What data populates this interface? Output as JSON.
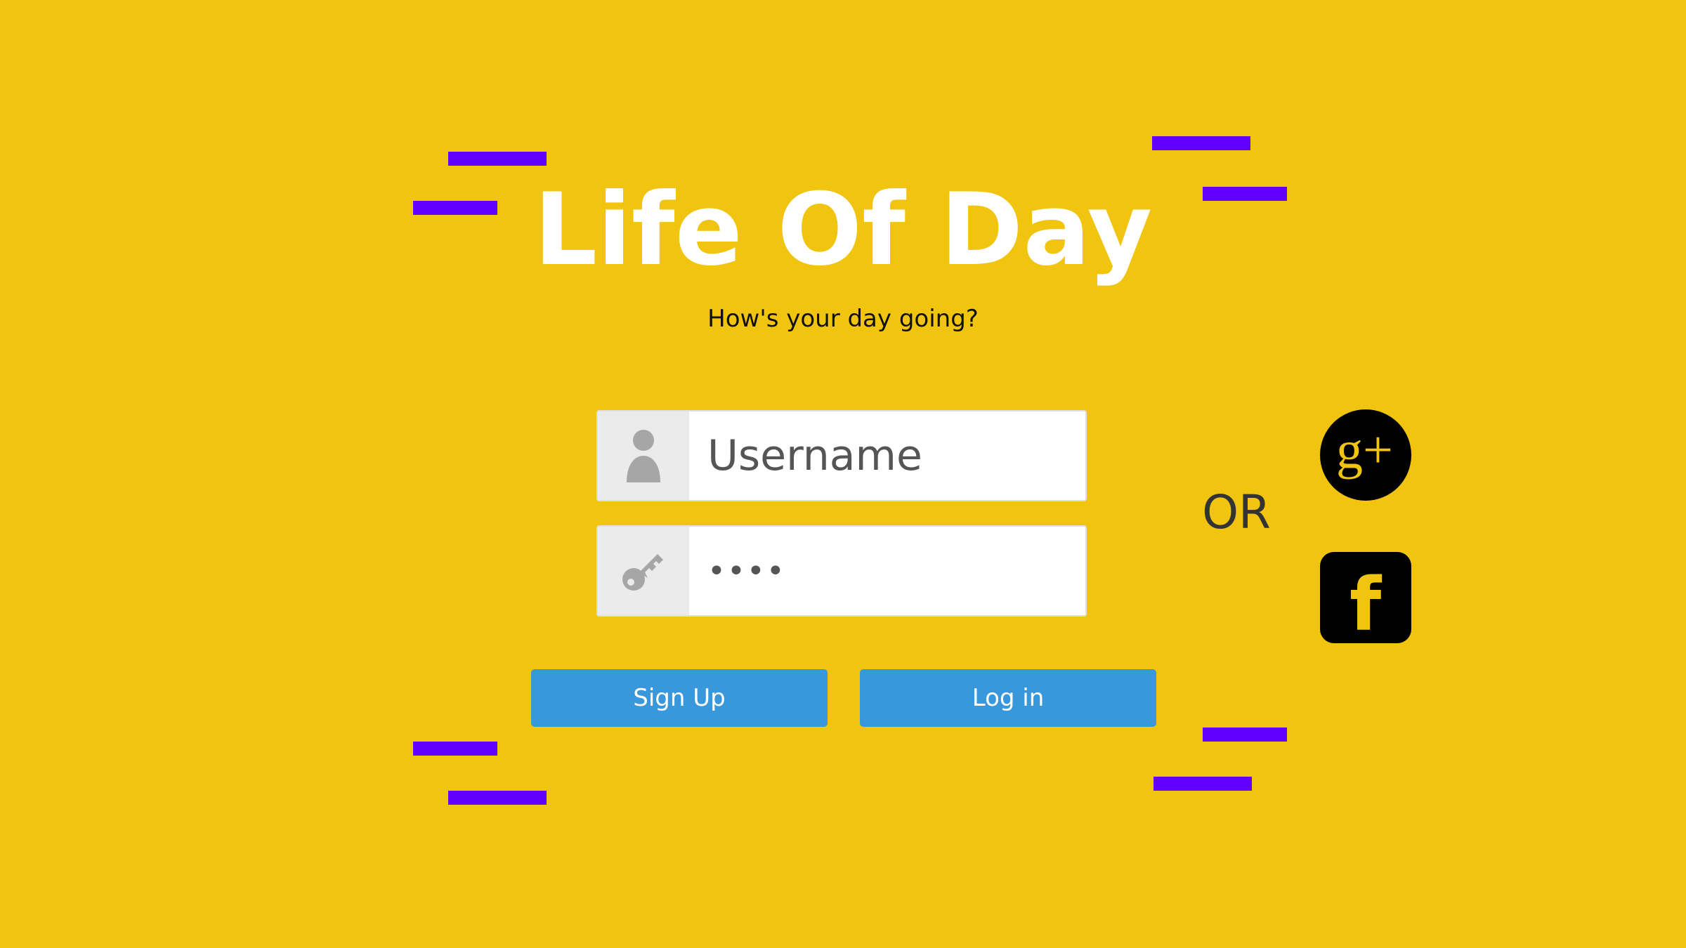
{
  "app": {
    "title": "Life Of Day",
    "tagline": "How's your day going?"
  },
  "login_form": {
    "username": {
      "placeholder": "Username",
      "icon": "user-icon"
    },
    "password": {
      "value": "••••",
      "icon": "key-icon"
    },
    "signup_label": "Sign Up",
    "login_label": "Log in"
  },
  "alt_login": {
    "or_label": "OR",
    "providers": [
      {
        "icon": "google-plus-icon",
        "glyph": "g+"
      },
      {
        "icon": "facebook-icon",
        "glyph": "f"
      }
    ]
  },
  "colors": {
    "background": "#F1C40F",
    "accent_lines": "#6200FF",
    "button": "#3898DB",
    "title": "#FFFFFF"
  }
}
